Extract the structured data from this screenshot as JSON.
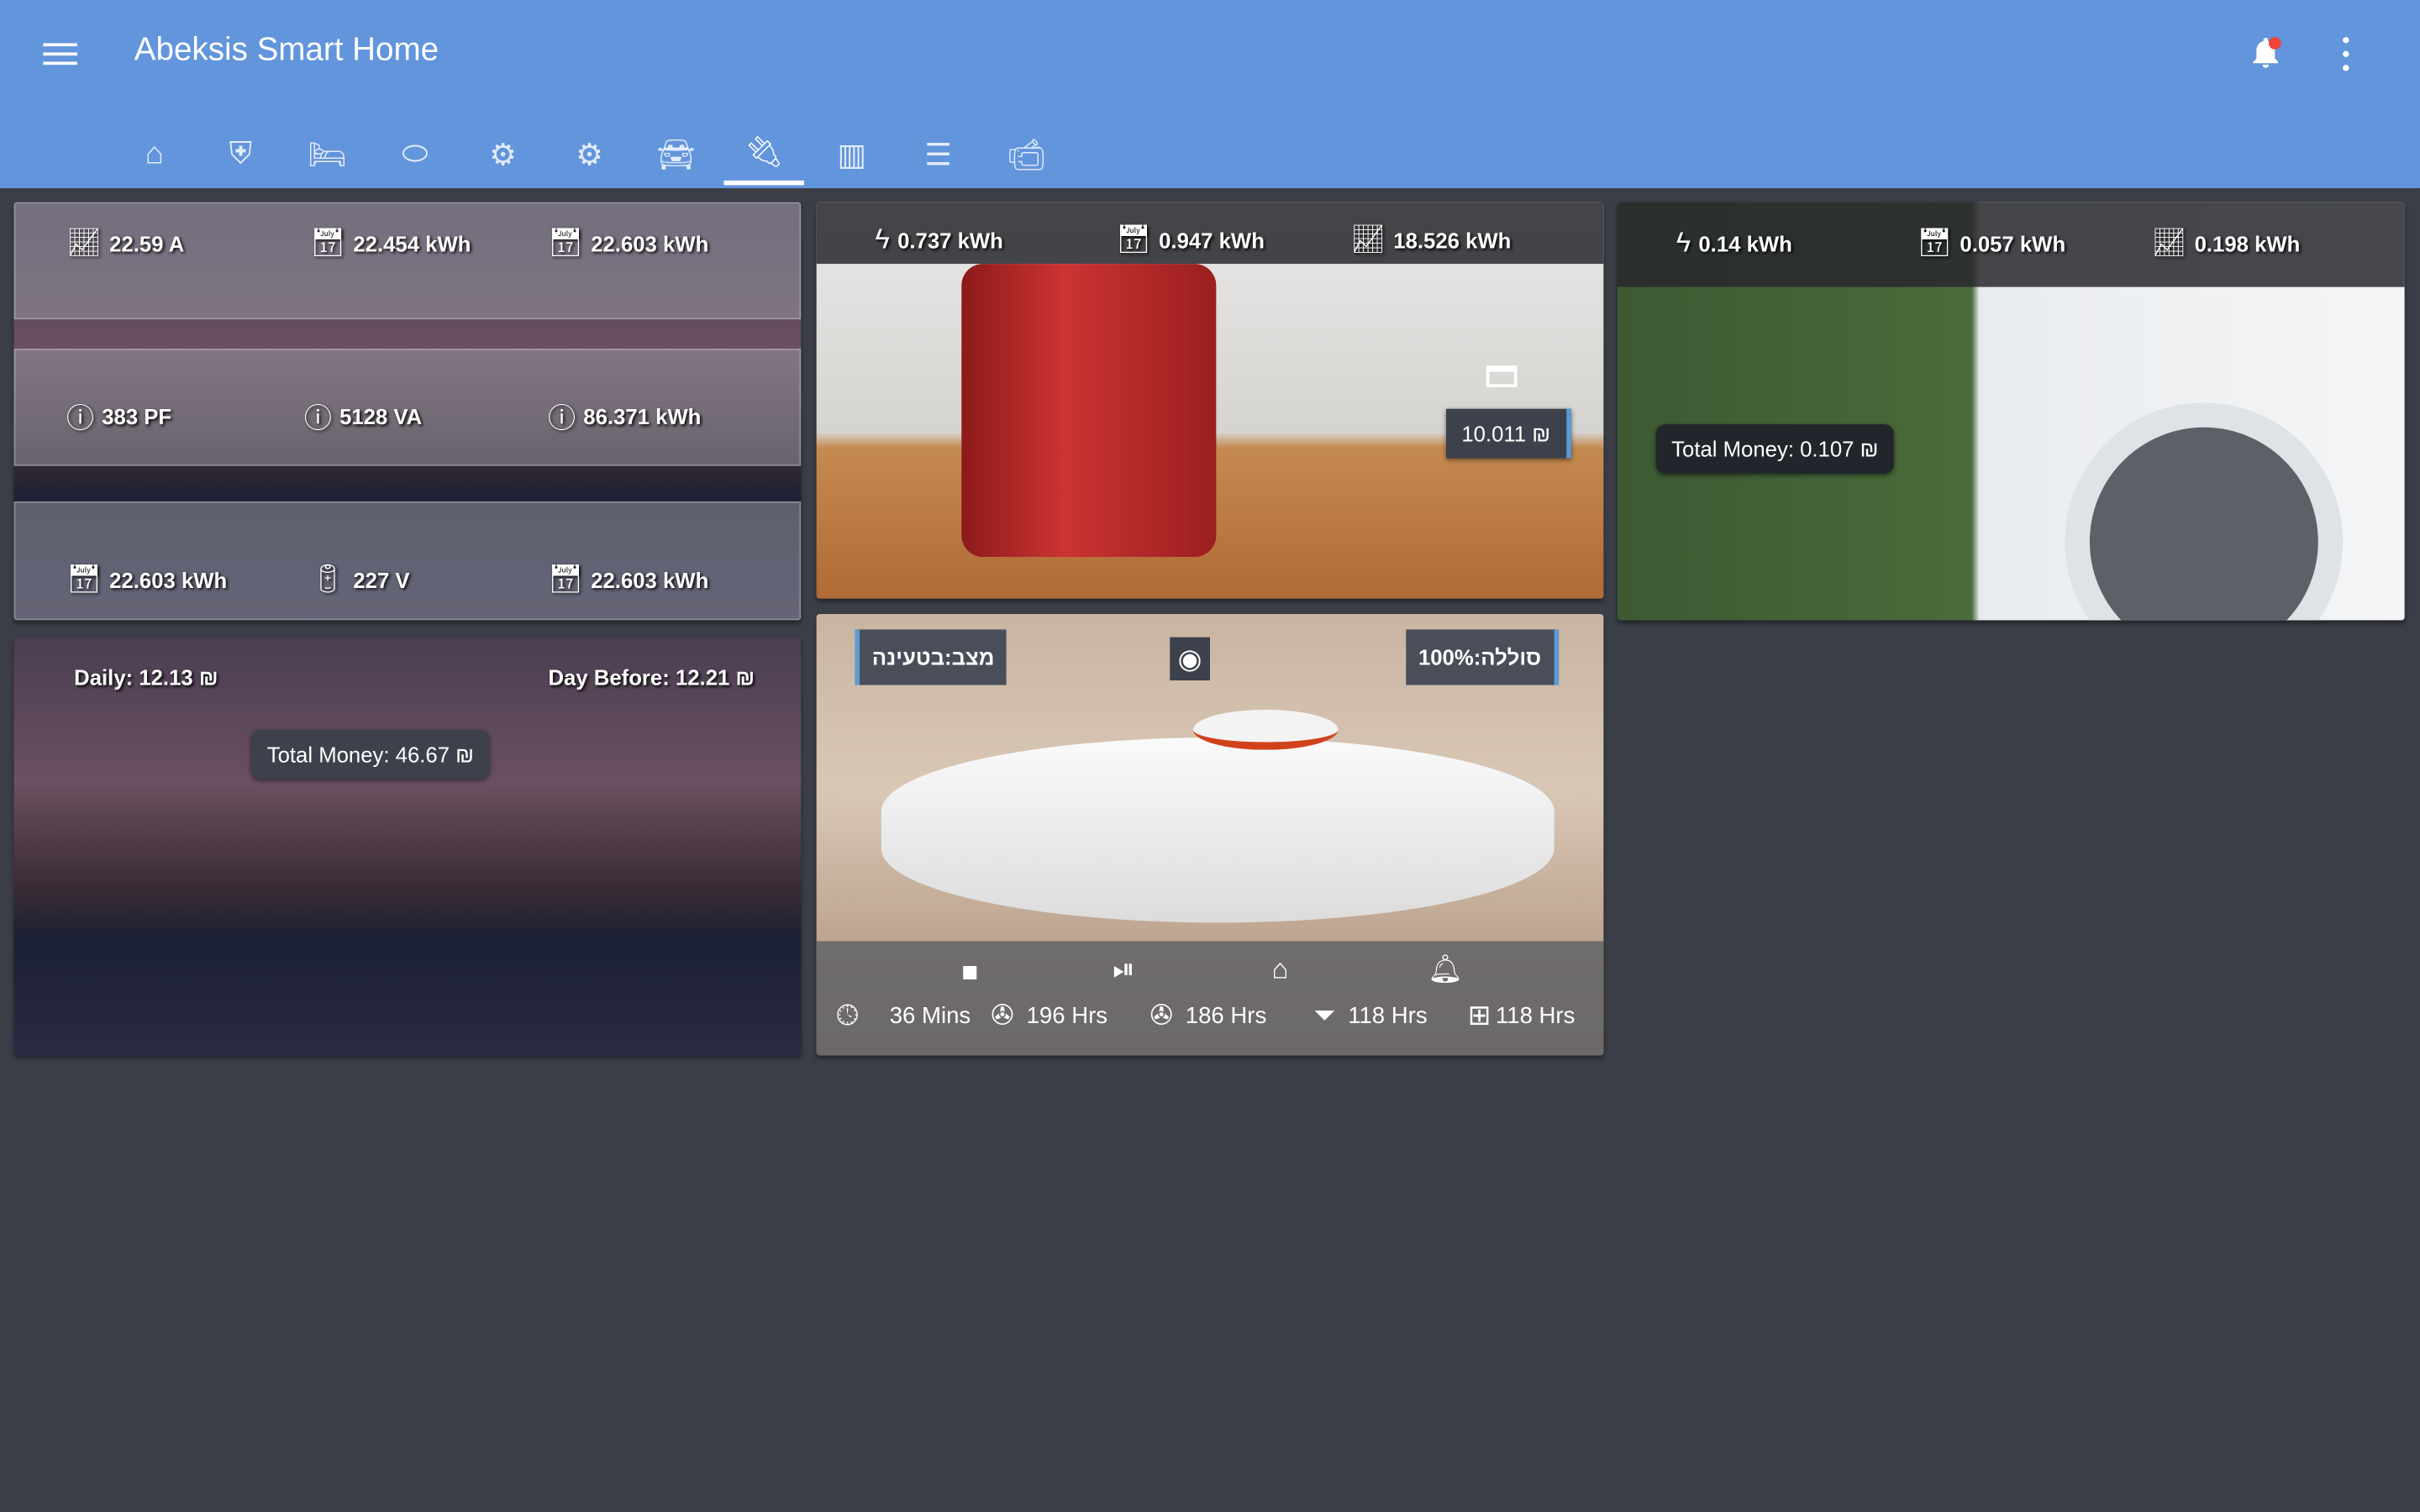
{
  "header": {
    "title": "Abeksis Smart Home"
  },
  "tabs": [
    {
      "icon": "home-assistant-icon"
    },
    {
      "icon": "shield-home-icon"
    },
    {
      "icon": "bed-icon"
    },
    {
      "icon": "toggle-icon"
    },
    {
      "icon": "gear-icon"
    },
    {
      "icon": "gears-icon"
    },
    {
      "icon": "car-icon"
    },
    {
      "icon": "power-plug-icon",
      "active": true
    },
    {
      "icon": "building-icon"
    },
    {
      "icon": "server-icon"
    },
    {
      "icon": "cctv-icon"
    }
  ],
  "energy": {
    "rows": [
      [
        {
          "icon": "trend",
          "value": "22.59 A"
        },
        {
          "icon": "calendar",
          "value": "22.454 kWh"
        },
        {
          "icon": "calendar",
          "value": "22.603 kWh"
        }
      ],
      [
        {
          "icon": "info",
          "value": "383 PF"
        },
        {
          "icon": "info",
          "value": "5128 VA"
        },
        {
          "icon": "info",
          "value": "86.371 kWh"
        }
      ],
      [
        {
          "icon": "calendar",
          "value": "22.603 kWh"
        },
        {
          "icon": "battery-charging",
          "value": "227 V"
        },
        {
          "icon": "calendar",
          "value": "22.603 kWh"
        }
      ]
    ]
  },
  "money": {
    "daily": "Daily: 12.13 ₪",
    "day_before": "Day Before: 12.21 ₪",
    "total": "Total Money: 46.67 ₪"
  },
  "coffee": {
    "power": "0.737 kWh",
    "daily": "0.947 kWh",
    "total": "18.526 kWh",
    "cost": "10.011 ₪"
  },
  "washer": {
    "power": "0.14 kWh",
    "daily": "0.057 kWh",
    "total": "0.198 kWh",
    "money": "Total Money: 0.107 ₪"
  },
  "vacuum": {
    "status": "מצב:בטעינה",
    "battery": "סוללה:100%",
    "stats": [
      "36 Mins",
      "196 Hrs",
      "186 Hrs",
      "118 Hrs",
      "118 Hrs"
    ]
  },
  "colors": {
    "header": "#6295dc",
    "background": "#3b3e47"
  }
}
